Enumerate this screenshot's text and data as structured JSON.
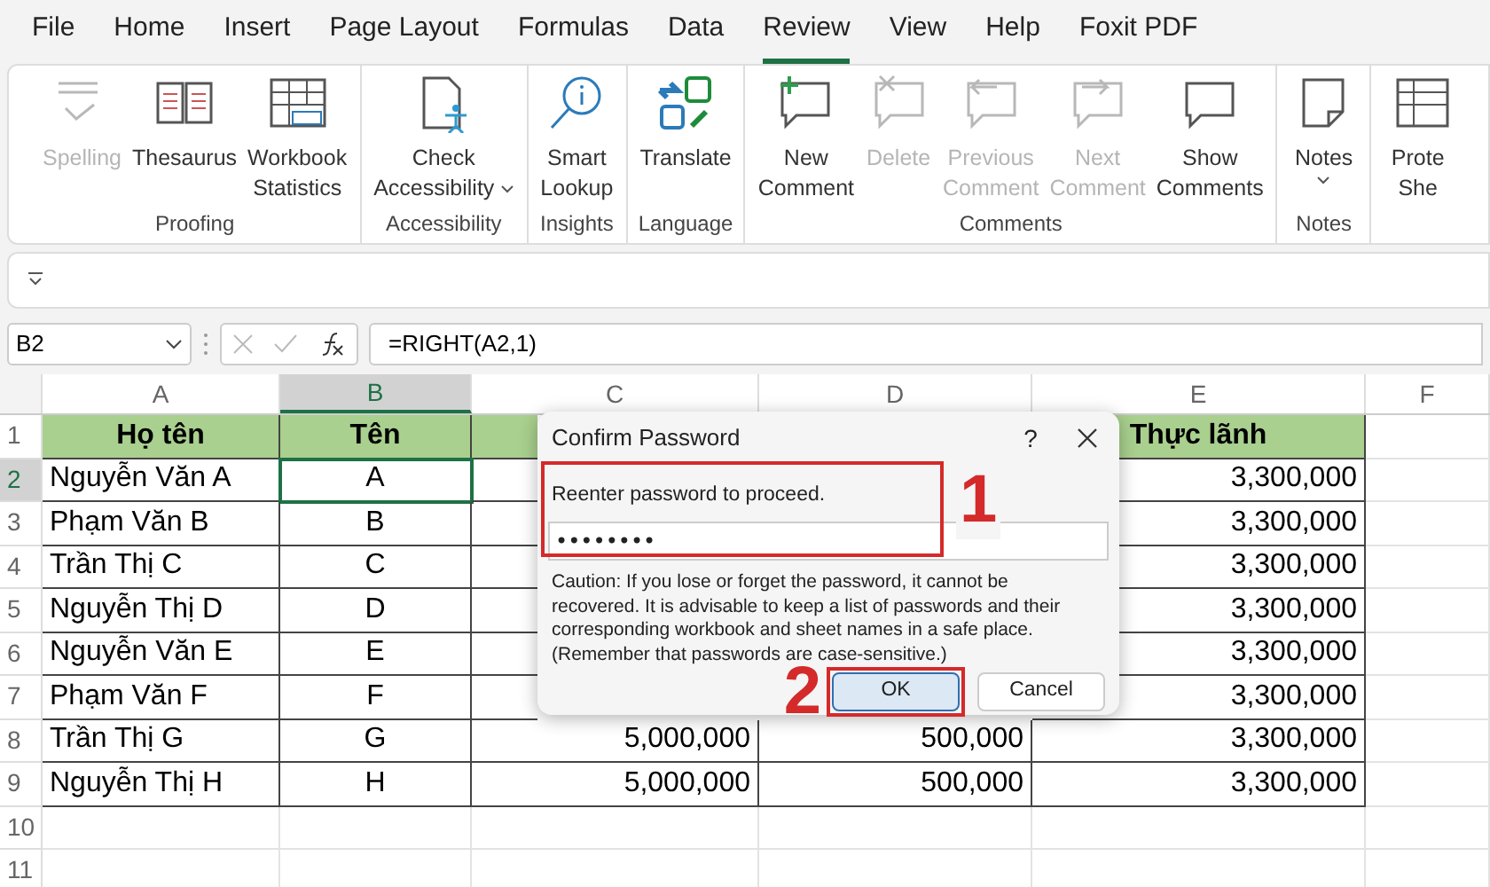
{
  "tabs": [
    {
      "label": "File",
      "selected": false
    },
    {
      "label": "Home",
      "selected": false
    },
    {
      "label": "Insert",
      "selected": false
    },
    {
      "label": "Page Layout",
      "selected": false
    },
    {
      "label": "Formulas",
      "selected": false
    },
    {
      "label": "Data",
      "selected": false
    },
    {
      "label": "Review",
      "selected": true
    },
    {
      "label": "View",
      "selected": false
    },
    {
      "label": "Help",
      "selected": false
    },
    {
      "label": "Foxit PDF",
      "selected": false
    }
  ],
  "ribbon": [
    {
      "label": "Proofing",
      "items": [
        {
          "lines": [
            "Spelling"
          ],
          "disabled": true,
          "dropdown": false
        },
        {
          "lines": [
            "Thesaurus"
          ],
          "disabled": false,
          "dropdown": false
        },
        {
          "lines": [
            "Workbook",
            "Statistics"
          ],
          "disabled": false,
          "dropdown": false
        }
      ]
    },
    {
      "label": "Accessibility",
      "items": [
        {
          "lines": [
            "Check",
            "Accessibility"
          ],
          "disabled": false,
          "dropdown": true
        }
      ]
    },
    {
      "label": "Insights",
      "items": [
        {
          "lines": [
            "Smart",
            "Lookup"
          ],
          "disabled": false,
          "dropdown": false
        }
      ]
    },
    {
      "label": "Language",
      "items": [
        {
          "lines": [
            "Translate"
          ],
          "disabled": false,
          "dropdown": false
        }
      ]
    },
    {
      "label": "Comments",
      "items": [
        {
          "lines": [
            "New",
            "Comment"
          ],
          "disabled": false,
          "dropdown": false
        },
        {
          "lines": [
            "Delete"
          ],
          "disabled": true,
          "dropdown": false
        },
        {
          "lines": [
            "Previous",
            "Comment"
          ],
          "disabled": true,
          "dropdown": false
        },
        {
          "lines": [
            "Next",
            "Comment"
          ],
          "disabled": true,
          "dropdown": false
        },
        {
          "lines": [
            "Show",
            "Comments"
          ],
          "disabled": false,
          "dropdown": false
        }
      ]
    },
    {
      "label": "Notes",
      "items": [
        {
          "lines": [
            "Notes"
          ],
          "disabled": false,
          "dropdown": true
        }
      ]
    },
    {
      "items": [
        {
          "lines": [
            "Prote",
            "She"
          ],
          "disabled": false,
          "dropdown": false
        }
      ]
    }
  ],
  "name_box": "B2",
  "formula": "=RIGHT(A2,1)",
  "sheet": {
    "columns": [
      {
        "label": "A",
        "selected": false
      },
      {
        "label": "B",
        "selected": true
      },
      {
        "label": "C",
        "selected": false
      },
      {
        "label": "D",
        "selected": false
      },
      {
        "label": "E",
        "selected": false
      },
      {
        "label": "F",
        "selected": false
      }
    ],
    "rows": [
      {
        "label": "1",
        "selected": false,
        "header": true,
        "cells": [
          "Họ tên",
          "Tên",
          null,
          null,
          "Thực lãnh",
          null
        ]
      },
      {
        "label": "2",
        "selected": true,
        "header": false,
        "cells": [
          "Nguyễn Văn A",
          "A",
          null,
          null,
          "3,300,000",
          null
        ]
      },
      {
        "label": "3",
        "selected": false,
        "header": false,
        "cells": [
          "Phạm Văn B",
          "B",
          null,
          null,
          "3,300,000",
          null
        ]
      },
      {
        "label": "4",
        "selected": false,
        "header": false,
        "cells": [
          "Trần Thị C",
          "C",
          null,
          null,
          "3,300,000",
          null
        ]
      },
      {
        "label": "5",
        "selected": false,
        "header": false,
        "cells": [
          "Nguyễn Thị D",
          "D",
          null,
          null,
          "3,300,000",
          null
        ]
      },
      {
        "label": "6",
        "selected": false,
        "header": false,
        "cells": [
          "Nguyễn Văn E",
          "E",
          null,
          null,
          "3,300,000",
          null
        ]
      },
      {
        "label": "7",
        "selected": false,
        "header": false,
        "cells": [
          "Phạm Văn F",
          "F",
          null,
          null,
          "3,300,000",
          null
        ]
      },
      {
        "label": "8",
        "selected": false,
        "header": false,
        "cells": [
          "Trần Thị G",
          "G",
          "5,000,000",
          "500,000",
          "3,300,000",
          null
        ]
      },
      {
        "label": "9",
        "selected": false,
        "header": false,
        "cells": [
          "Nguyễn Thị H",
          "H",
          "5,000,000",
          "500,000",
          "3,300,000",
          null
        ]
      },
      {
        "label": "10",
        "selected": false,
        "header": false,
        "cells": [
          null,
          null,
          null,
          null,
          null,
          null
        ]
      },
      {
        "label": "11",
        "selected": false,
        "header": false,
        "cells": [
          null,
          null,
          null,
          null,
          null,
          null
        ]
      }
    ]
  },
  "dialog": {
    "title": "Confirm Password",
    "help": "?",
    "prompt": "Reenter password to proceed.",
    "password": {
      "value": "••••••••",
      "annotation": "1"
    },
    "caution": "Caution: If you lose or forget the password, it cannot be recovered. It is advisable to keep a list of passwords and their corresponding workbook and sheet names in a safe place. (Remember that passwords are case-sensitive.)",
    "buttons": [
      {
        "label": "OK",
        "selected": true,
        "annotation": "2"
      },
      {
        "label": "Cancel",
        "selected": false
      }
    ]
  }
}
